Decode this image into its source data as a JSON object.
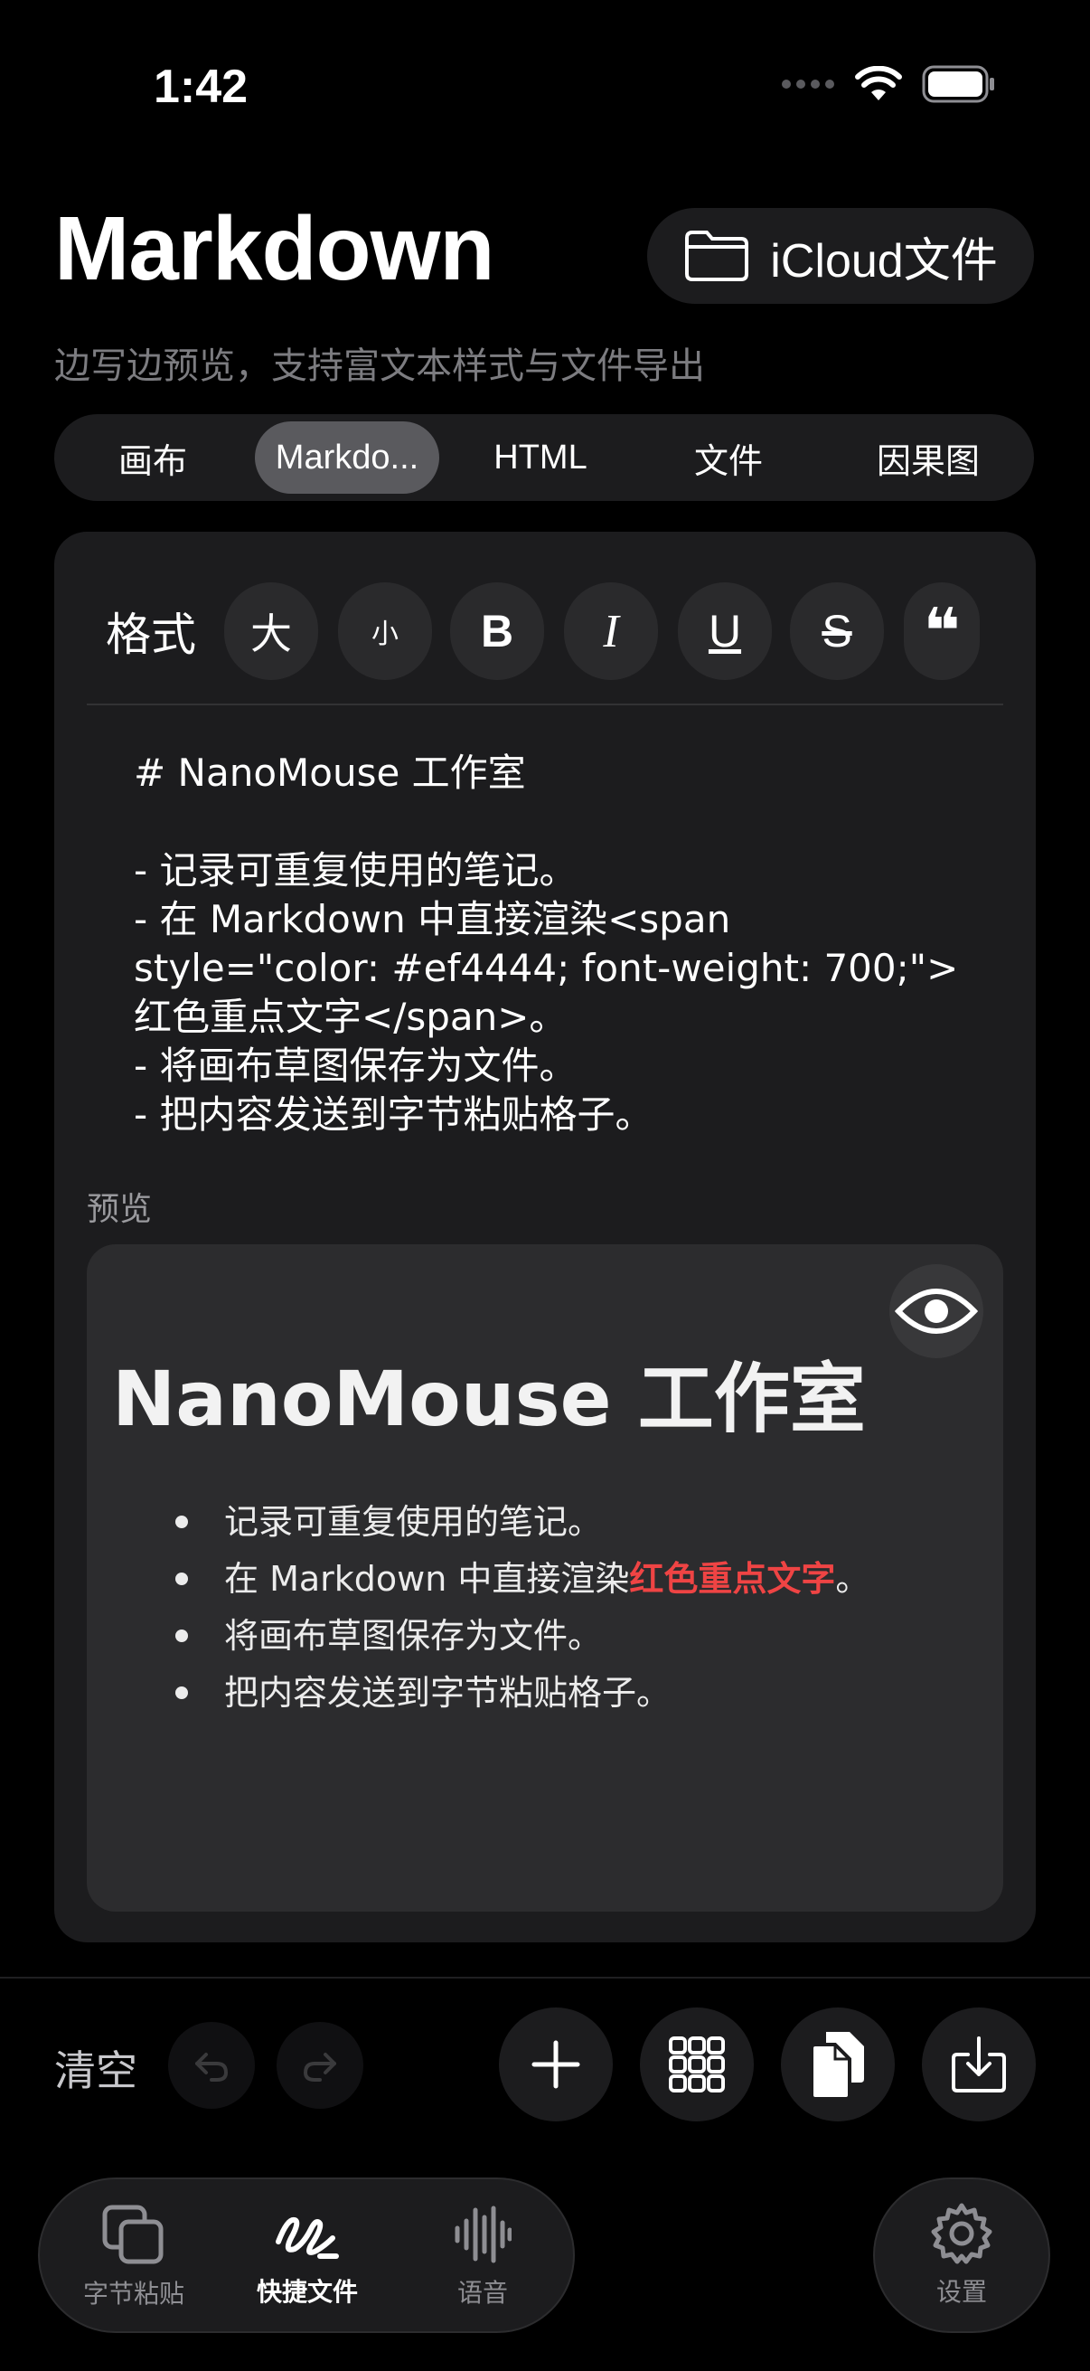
{
  "status_bar": {
    "time": "1:42"
  },
  "header": {
    "title": "Markdown",
    "subtitle": "边写边预览，支持富文本样式与文件导出",
    "icloud_label": "iCloud文件"
  },
  "segments": [
    {
      "label": "画布",
      "active": false
    },
    {
      "label": "Markdo...",
      "active": true
    },
    {
      "label": "HTML",
      "active": false
    },
    {
      "label": "文件",
      "active": false
    },
    {
      "label": "因果图",
      "active": false
    }
  ],
  "toolbar": {
    "format": "格式",
    "large": "大",
    "small": "小",
    "bold": "B",
    "italic": "I",
    "underline": "U",
    "strike": "S",
    "quote": "❝"
  },
  "editor": {
    "text": "# NanoMouse 工作室\n\n- 记录可重复使用的笔记。\n- 在 Markdown 中直接渲染<span\nstyle=\"color: #ef4444; font-weight: 700;\">\n红色重点文字</span>。\n- 将画布草图保存为文件。\n- 把内容发送到字节粘贴格子。"
  },
  "preview": {
    "label": "预览",
    "heading": "NanoMouse 工作室",
    "items": [
      "记录可重复使用的笔记。",
      "在 Markdown 中直接渲染",
      "将画布草图保存为文件。",
      "把内容发送到字节粘贴格子。"
    ],
    "item2_highlight": "红色重点文字",
    "item2_suffix": "。",
    "highlight_color": "#ef4444"
  },
  "bottom": {
    "clear_label": "清空"
  },
  "tabs": [
    {
      "label": "字节粘贴",
      "icon": "copy-squares-icon",
      "active": false
    },
    {
      "label": "快捷文件",
      "icon": "scribble-icon",
      "active": true
    },
    {
      "label": "语音",
      "icon": "waveform-icon",
      "active": false
    }
  ],
  "settings_label": "设置"
}
